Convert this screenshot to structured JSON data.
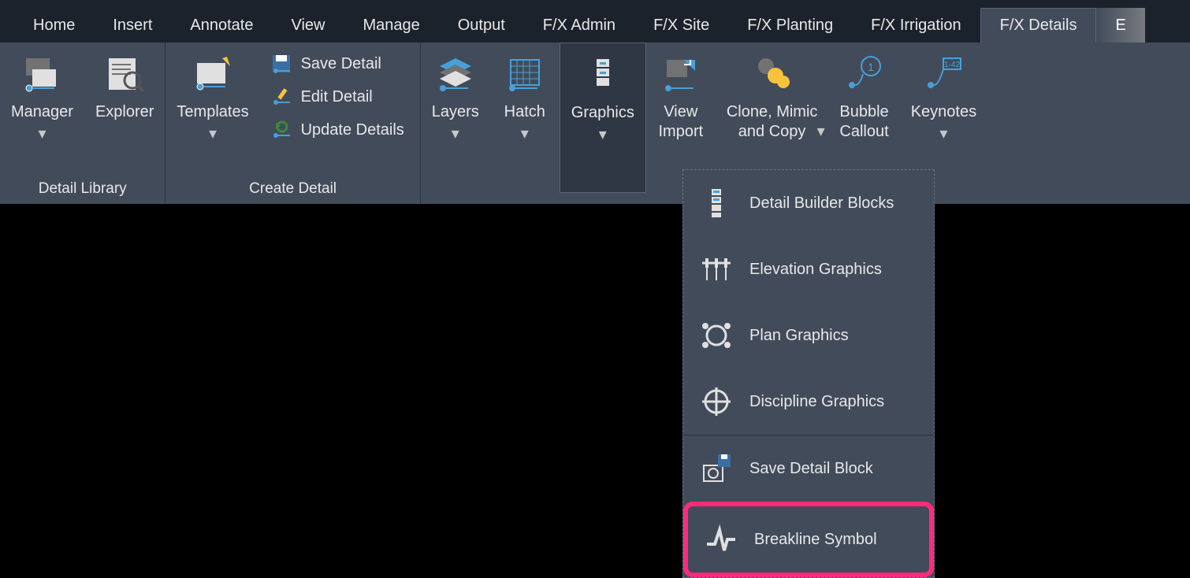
{
  "tabs": {
    "home": "Home",
    "insert": "Insert",
    "annotate": "Annotate",
    "view": "View",
    "manage": "Manage",
    "output": "Output",
    "fx_admin": "F/X Admin",
    "fx_site": "F/X Site",
    "fx_planting": "F/X Planting",
    "fx_irrigation": "F/X Irrigation",
    "fx_details": "F/X Details",
    "extra": "E"
  },
  "panels": {
    "detail_library": {
      "title": "Detail Library",
      "manager": "Manager",
      "explorer": "Explorer"
    },
    "create_detail": {
      "title": "Create Detail",
      "templates": "Templates",
      "save_detail": "Save Detail",
      "edit_detail": "Edit Detail",
      "update_details": "Update Details"
    },
    "tools": {
      "layers": "Layers",
      "hatch": "Hatch",
      "graphics": "Graphics",
      "view_import": "View\nImport",
      "clone_mimic": "Clone, Mimic\nand Copy",
      "bubble_callout": "Bubble\nCallout",
      "keynotes": "Keynotes"
    }
  },
  "dropdown": {
    "detail_builder_blocks": "Detail Builder Blocks",
    "elevation_graphics": "Elevation Graphics",
    "plan_graphics": "Plan Graphics",
    "discipline_graphics": "Discipline Graphics",
    "save_detail_block": "Save Detail Block",
    "breakline_symbol": "Breakline Symbol"
  }
}
